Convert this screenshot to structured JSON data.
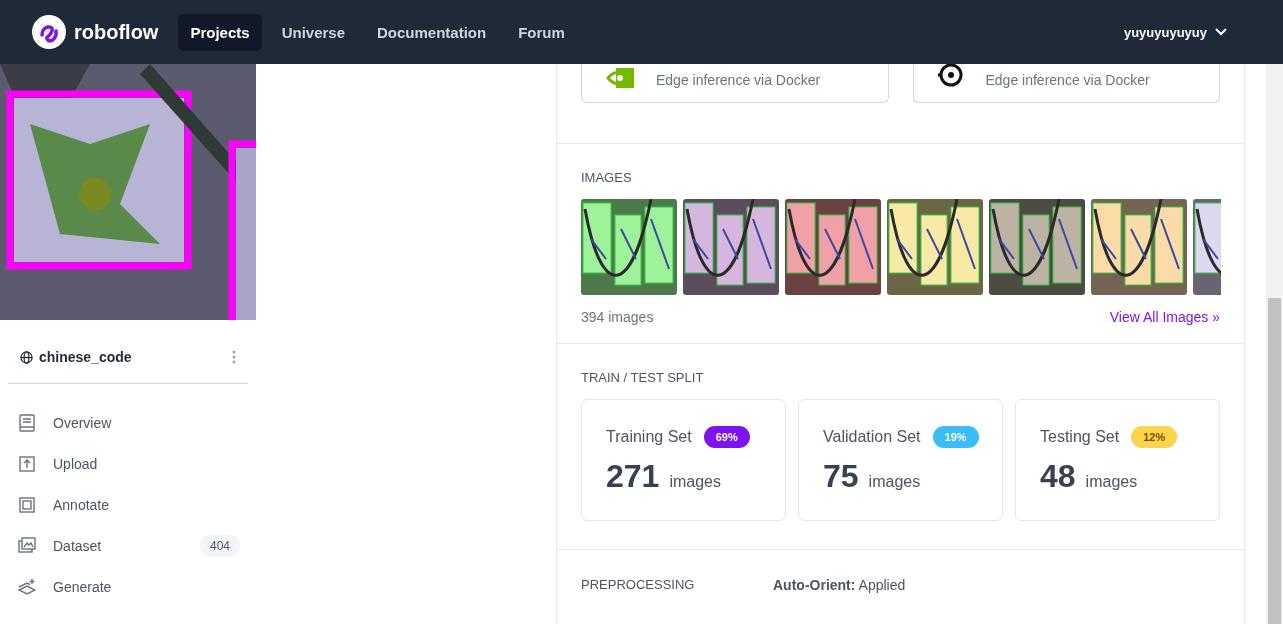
{
  "nav": {
    "brand": "roboflow",
    "links": [
      {
        "label": "Projects",
        "selected": true
      },
      {
        "label": "Universe",
        "selected": false
      },
      {
        "label": "Documentation",
        "selected": false
      },
      {
        "label": "Forum",
        "selected": false
      }
    ],
    "user": "yuyuyuyuyuy"
  },
  "sidebar": {
    "project": "chinese_code",
    "items": [
      {
        "label": "Overview",
        "kind": "book",
        "selected": false
      },
      {
        "label": "Upload",
        "kind": "upload",
        "selected": false
      },
      {
        "label": "Annotate",
        "kind": "annotate",
        "selected": false
      },
      {
        "label": "Dataset",
        "kind": "images",
        "selected": false,
        "count": "404"
      },
      {
        "label": "Generate",
        "kind": "layers",
        "selected": false
      }
    ]
  },
  "deploy": [
    {
      "subtitle": "Edge inference via Docker",
      "kind": "eye"
    },
    {
      "subtitle": "Edge inference via Docker",
      "kind": "target"
    }
  ],
  "images": {
    "heading": "IMAGES",
    "count": "394 images",
    "link": "View All Images »"
  },
  "split": {
    "heading": "TRAIN / TEST SPLIT",
    "sets": [
      {
        "name": "Training Set",
        "percent": "69%",
        "color": "#7c14f0",
        "number": "271",
        "unit": "images"
      },
      {
        "name": "Validation Set",
        "percent": "19%",
        "color": "#38bdf8",
        "number": "75",
        "unit": "images"
      },
      {
        "name": "Testing Set",
        "percent": "12%",
        "color": "#fcd34d",
        "number": "48",
        "unit": "images"
      }
    ]
  },
  "preprocessing": {
    "heading": "PREPROCESSING",
    "rows": [
      {
        "label": "Auto-Orient:",
        "value": "Applied"
      }
    ]
  }
}
